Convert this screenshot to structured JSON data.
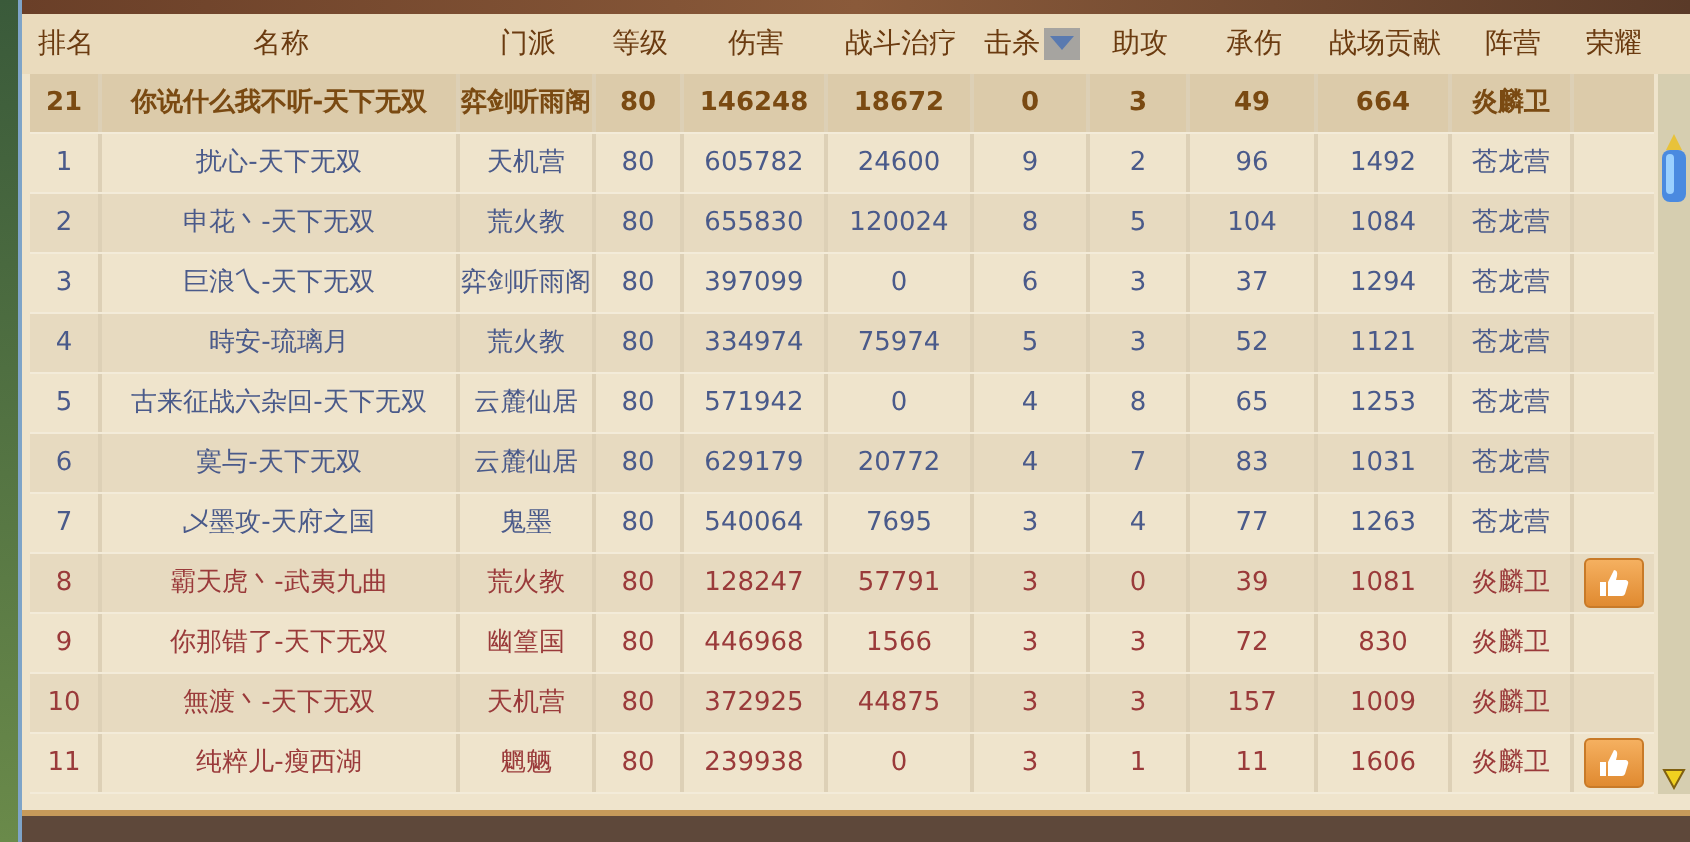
{
  "columns": [
    {
      "label": "排名",
      "sorted": false
    },
    {
      "label": "名称",
      "sorted": false
    },
    {
      "label": "门派",
      "sorted": false
    },
    {
      "label": "等级",
      "sorted": false
    },
    {
      "label": "伤害",
      "sorted": false
    },
    {
      "label": "战斗治疗",
      "sorted": false
    },
    {
      "label": "击杀",
      "sorted": true
    },
    {
      "label": "助攻",
      "sorted": false
    },
    {
      "label": "承伤",
      "sorted": false
    },
    {
      "label": "战场贡献",
      "sorted": false
    },
    {
      "label": "阵营",
      "sorted": false
    },
    {
      "label": "荣耀",
      "sorted": false
    }
  ],
  "rows": [
    {
      "selected": true,
      "color": "#7a4a12",
      "liked": false,
      "cells": [
        "21",
        "你说什么我不听-天下无双",
        "弈剑听雨阁",
        "80",
        "146248",
        "18672",
        "0",
        "3",
        "49",
        "664",
        "炎麟卫"
      ]
    },
    {
      "selected": false,
      "color": "#4a5a8a",
      "liked": false,
      "cells": [
        "1",
        "扰心-天下无双",
        "天机营",
        "80",
        "605782",
        "24600",
        "9",
        "2",
        "96",
        "1492",
        "苍龙营"
      ]
    },
    {
      "selected": false,
      "color": "#4a5a8a",
      "liked": false,
      "cells": [
        "2",
        "申花丶-天下无双",
        "荒火教",
        "80",
        "655830",
        "120024",
        "8",
        "5",
        "104",
        "1084",
        "苍龙营"
      ]
    },
    {
      "selected": false,
      "color": "#4a5a8a",
      "liked": false,
      "cells": [
        "3",
        "巨浪乀-天下无双",
        "弈剑听雨阁",
        "80",
        "397099",
        "0",
        "6",
        "3",
        "37",
        "1294",
        "苍龙营"
      ]
    },
    {
      "selected": false,
      "color": "#4a5a8a",
      "liked": false,
      "cells": [
        "4",
        "時安-琉璃月",
        "荒火教",
        "80",
        "334974",
        "75974",
        "5",
        "3",
        "52",
        "1121",
        "苍龙营"
      ]
    },
    {
      "selected": false,
      "color": "#4a5a8a",
      "liked": false,
      "cells": [
        "5",
        "古来征战六杂回-天下无双",
        "云麓仙居",
        "80",
        "571942",
        "0",
        "4",
        "8",
        "65",
        "1253",
        "苍龙营"
      ]
    },
    {
      "selected": false,
      "color": "#4a5a8a",
      "liked": false,
      "cells": [
        "6",
        "寞与-天下无双",
        "云麓仙居",
        "80",
        "629179",
        "20772",
        "4",
        "7",
        "83",
        "1031",
        "苍龙营"
      ]
    },
    {
      "selected": false,
      "color": "#4a5a8a",
      "liked": false,
      "cells": [
        "7",
        "乄墨攻-天府之国",
        "鬼墨",
        "80",
        "540064",
        "7695",
        "3",
        "4",
        "77",
        "1263",
        "苍龙营"
      ]
    },
    {
      "selected": false,
      "color": "#9a3a3a",
      "liked": true,
      "cells": [
        "8",
        "霸天虎丶-武夷九曲",
        "荒火教",
        "80",
        "128247",
        "57791",
        "3",
        "0",
        "39",
        "1081",
        "炎麟卫"
      ]
    },
    {
      "selected": false,
      "color": "#9a3a3a",
      "liked": false,
      "cells": [
        "9",
        "你那错了-天下无双",
        "幽篁国",
        "80",
        "446968",
        "1566",
        "3",
        "3",
        "72",
        "830",
        "炎麟卫"
      ]
    },
    {
      "selected": false,
      "color": "#9a3a3a",
      "liked": false,
      "cells": [
        "10",
        "無渡丶-天下无双",
        "天机营",
        "80",
        "372925",
        "44875",
        "3",
        "3",
        "157",
        "1009",
        "炎麟卫"
      ]
    },
    {
      "selected": false,
      "color": "#9a3a3a",
      "liked": true,
      "cells": [
        "11",
        "纯粹儿-瘦西湖",
        "魍魉",
        "80",
        "239938",
        "0",
        "3",
        "1",
        "11",
        "1606",
        "炎麟卫"
      ]
    }
  ]
}
